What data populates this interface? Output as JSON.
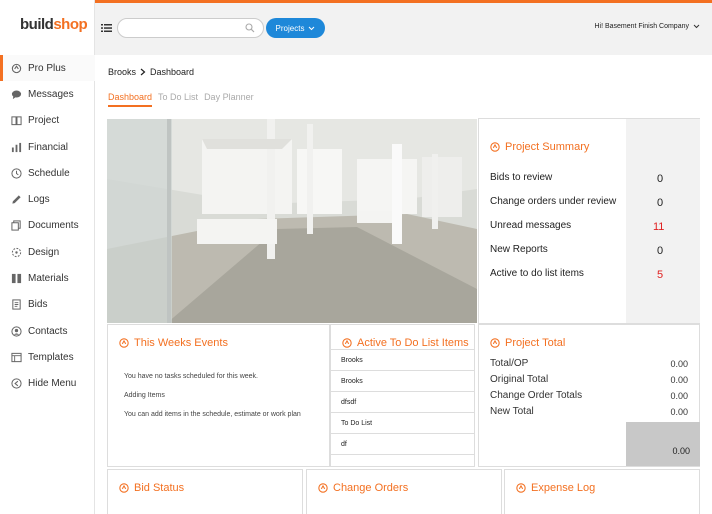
{
  "brand": {
    "part1": "build",
    "part2": "shop"
  },
  "sidebar": {
    "items": [
      {
        "label": "Pro Plus",
        "icon": "pro-plus-icon"
      },
      {
        "label": "Messages",
        "icon": "message-icon"
      },
      {
        "label": "Project",
        "icon": "book-icon"
      },
      {
        "label": "Financial",
        "icon": "chart-icon"
      },
      {
        "label": "Schedule",
        "icon": "clock-icon"
      },
      {
        "label": "Logs",
        "icon": "pencil-icon"
      },
      {
        "label": "Documents",
        "icon": "documents-icon"
      },
      {
        "label": "Design",
        "icon": "design-icon"
      },
      {
        "label": "Materials",
        "icon": "materials-icon"
      },
      {
        "label": "Bids",
        "icon": "bids-icon"
      },
      {
        "label": "Contacts",
        "icon": "contacts-icon"
      },
      {
        "label": "Templates",
        "icon": "templates-icon"
      },
      {
        "label": "Hide Menu",
        "icon": "hide-menu-icon"
      }
    ]
  },
  "header": {
    "search_placeholder": "",
    "projects_label": "Projects",
    "company": "Hi! Basement Finish Company"
  },
  "breadcrumb": {
    "root": "Brooks",
    "current": "Dashboard"
  },
  "tabs": [
    {
      "label": "Dashboard"
    },
    {
      "label": "To Do List"
    },
    {
      "label": "Day Planner"
    }
  ],
  "project_summary": {
    "title": "Project Summary",
    "rows": [
      {
        "label": "Bids to review",
        "value": "0"
      },
      {
        "label": "Change orders under review",
        "value": "0"
      },
      {
        "label": "Unread messages",
        "value": "11"
      },
      {
        "label": "New Reports",
        "value": "0"
      },
      {
        "label": "Active to do list items",
        "value": "5"
      }
    ]
  },
  "weeks_events": {
    "title": "This Weeks Events",
    "lines": [
      "You have no tasks scheduled for this week.",
      "Adding Items",
      "You can add items in the schedule, estimate or work plan"
    ]
  },
  "todo": {
    "title": "Active To Do List Items",
    "items": [
      "Brooks",
      "Brooks",
      "dfsdf",
      "To Do List",
      "df"
    ]
  },
  "project_total": {
    "title": "Project Total",
    "rows": [
      {
        "label": "Total/OP",
        "value": "0.00"
      },
      {
        "label": "Original Total",
        "value": "0.00"
      },
      {
        "label": "Change Order Totals",
        "value": "0.00"
      },
      {
        "label": "New Total",
        "value": "0.00"
      }
    ],
    "grand": "0.00"
  },
  "bottom_cards": [
    {
      "title": "Bid Status"
    },
    {
      "title": "Change Orders"
    },
    {
      "title": "Expense Log"
    }
  ],
  "colors": {
    "accent": "#f37021",
    "primary": "#1e88d9",
    "alert": "#e02020"
  }
}
